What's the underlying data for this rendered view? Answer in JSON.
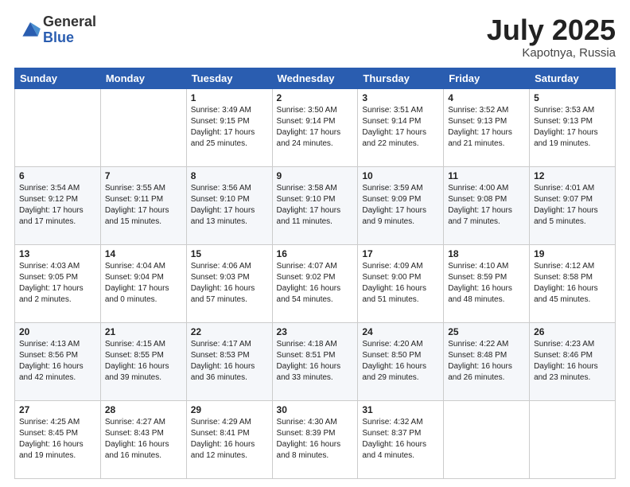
{
  "logo": {
    "general": "General",
    "blue": "Blue"
  },
  "header": {
    "month": "July 2025",
    "location": "Kapotnya, Russia"
  },
  "weekdays": [
    "Sunday",
    "Monday",
    "Tuesday",
    "Wednesday",
    "Thursday",
    "Friday",
    "Saturday"
  ],
  "weeks": [
    [
      {
        "day": "",
        "info": ""
      },
      {
        "day": "",
        "info": ""
      },
      {
        "day": "1",
        "info": "Sunrise: 3:49 AM\nSunset: 9:15 PM\nDaylight: 17 hours and 25 minutes."
      },
      {
        "day": "2",
        "info": "Sunrise: 3:50 AM\nSunset: 9:14 PM\nDaylight: 17 hours and 24 minutes."
      },
      {
        "day": "3",
        "info": "Sunrise: 3:51 AM\nSunset: 9:14 PM\nDaylight: 17 hours and 22 minutes."
      },
      {
        "day": "4",
        "info": "Sunrise: 3:52 AM\nSunset: 9:13 PM\nDaylight: 17 hours and 21 minutes."
      },
      {
        "day": "5",
        "info": "Sunrise: 3:53 AM\nSunset: 9:13 PM\nDaylight: 17 hours and 19 minutes."
      }
    ],
    [
      {
        "day": "6",
        "info": "Sunrise: 3:54 AM\nSunset: 9:12 PM\nDaylight: 17 hours and 17 minutes."
      },
      {
        "day": "7",
        "info": "Sunrise: 3:55 AM\nSunset: 9:11 PM\nDaylight: 17 hours and 15 minutes."
      },
      {
        "day": "8",
        "info": "Sunrise: 3:56 AM\nSunset: 9:10 PM\nDaylight: 17 hours and 13 minutes."
      },
      {
        "day": "9",
        "info": "Sunrise: 3:58 AM\nSunset: 9:10 PM\nDaylight: 17 hours and 11 minutes."
      },
      {
        "day": "10",
        "info": "Sunrise: 3:59 AM\nSunset: 9:09 PM\nDaylight: 17 hours and 9 minutes."
      },
      {
        "day": "11",
        "info": "Sunrise: 4:00 AM\nSunset: 9:08 PM\nDaylight: 17 hours and 7 minutes."
      },
      {
        "day": "12",
        "info": "Sunrise: 4:01 AM\nSunset: 9:07 PM\nDaylight: 17 hours and 5 minutes."
      }
    ],
    [
      {
        "day": "13",
        "info": "Sunrise: 4:03 AM\nSunset: 9:05 PM\nDaylight: 17 hours and 2 minutes."
      },
      {
        "day": "14",
        "info": "Sunrise: 4:04 AM\nSunset: 9:04 PM\nDaylight: 17 hours and 0 minutes."
      },
      {
        "day": "15",
        "info": "Sunrise: 4:06 AM\nSunset: 9:03 PM\nDaylight: 16 hours and 57 minutes."
      },
      {
        "day": "16",
        "info": "Sunrise: 4:07 AM\nSunset: 9:02 PM\nDaylight: 16 hours and 54 minutes."
      },
      {
        "day": "17",
        "info": "Sunrise: 4:09 AM\nSunset: 9:00 PM\nDaylight: 16 hours and 51 minutes."
      },
      {
        "day": "18",
        "info": "Sunrise: 4:10 AM\nSunset: 8:59 PM\nDaylight: 16 hours and 48 minutes."
      },
      {
        "day": "19",
        "info": "Sunrise: 4:12 AM\nSunset: 8:58 PM\nDaylight: 16 hours and 45 minutes."
      }
    ],
    [
      {
        "day": "20",
        "info": "Sunrise: 4:13 AM\nSunset: 8:56 PM\nDaylight: 16 hours and 42 minutes."
      },
      {
        "day": "21",
        "info": "Sunrise: 4:15 AM\nSunset: 8:55 PM\nDaylight: 16 hours and 39 minutes."
      },
      {
        "day": "22",
        "info": "Sunrise: 4:17 AM\nSunset: 8:53 PM\nDaylight: 16 hours and 36 minutes."
      },
      {
        "day": "23",
        "info": "Sunrise: 4:18 AM\nSunset: 8:51 PM\nDaylight: 16 hours and 33 minutes."
      },
      {
        "day": "24",
        "info": "Sunrise: 4:20 AM\nSunset: 8:50 PM\nDaylight: 16 hours and 29 minutes."
      },
      {
        "day": "25",
        "info": "Sunrise: 4:22 AM\nSunset: 8:48 PM\nDaylight: 16 hours and 26 minutes."
      },
      {
        "day": "26",
        "info": "Sunrise: 4:23 AM\nSunset: 8:46 PM\nDaylight: 16 hours and 23 minutes."
      }
    ],
    [
      {
        "day": "27",
        "info": "Sunrise: 4:25 AM\nSunset: 8:45 PM\nDaylight: 16 hours and 19 minutes."
      },
      {
        "day": "28",
        "info": "Sunrise: 4:27 AM\nSunset: 8:43 PM\nDaylight: 16 hours and 16 minutes."
      },
      {
        "day": "29",
        "info": "Sunrise: 4:29 AM\nSunset: 8:41 PM\nDaylight: 16 hours and 12 minutes."
      },
      {
        "day": "30",
        "info": "Sunrise: 4:30 AM\nSunset: 8:39 PM\nDaylight: 16 hours and 8 minutes."
      },
      {
        "day": "31",
        "info": "Sunrise: 4:32 AM\nSunset: 8:37 PM\nDaylight: 16 hours and 4 minutes."
      },
      {
        "day": "",
        "info": ""
      },
      {
        "day": "",
        "info": ""
      }
    ]
  ]
}
